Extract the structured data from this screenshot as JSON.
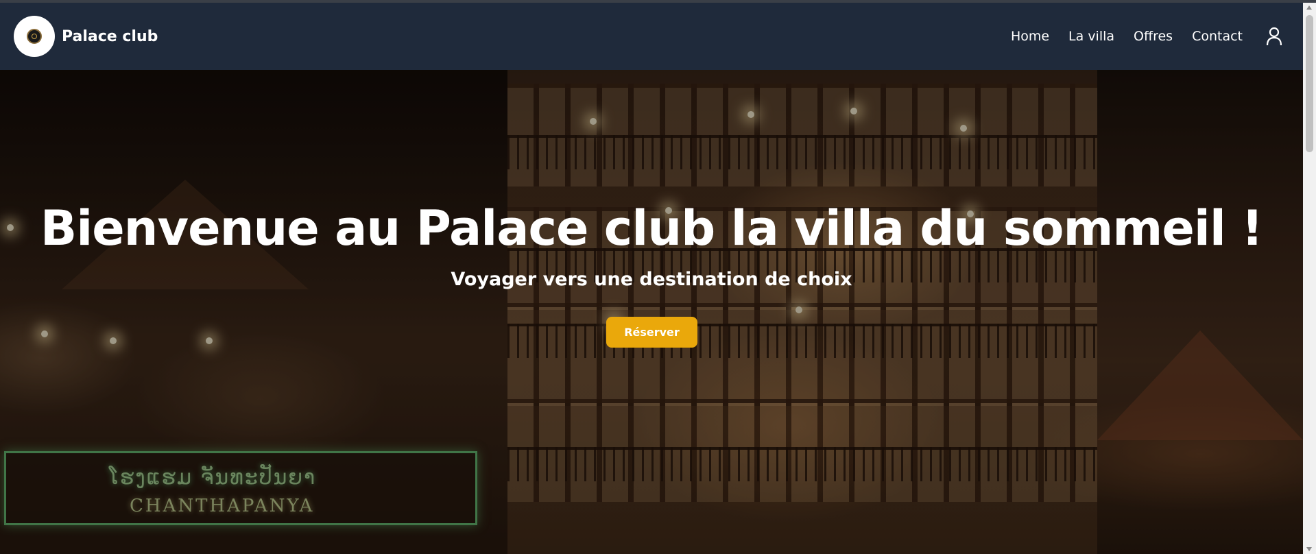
{
  "navbar": {
    "brand": "Palace club",
    "links": [
      "Home",
      "La villa",
      "Offres",
      "Contact"
    ],
    "user_icon": "user-icon"
  },
  "hero": {
    "title": "Bienvenue au Palace club la villa du sommeil !",
    "subtitle": "Voyager vers une destination de choix",
    "button_label": "Réserver",
    "sign_text": "ໂຮງແຮມ ຈັນທະປັນຍາ",
    "sign_sub": "CHANTHAPANYA"
  },
  "colors": {
    "navbar_bg": "#1f2a3b",
    "button_bg": "#eaa80b",
    "text": "#ffffff"
  }
}
